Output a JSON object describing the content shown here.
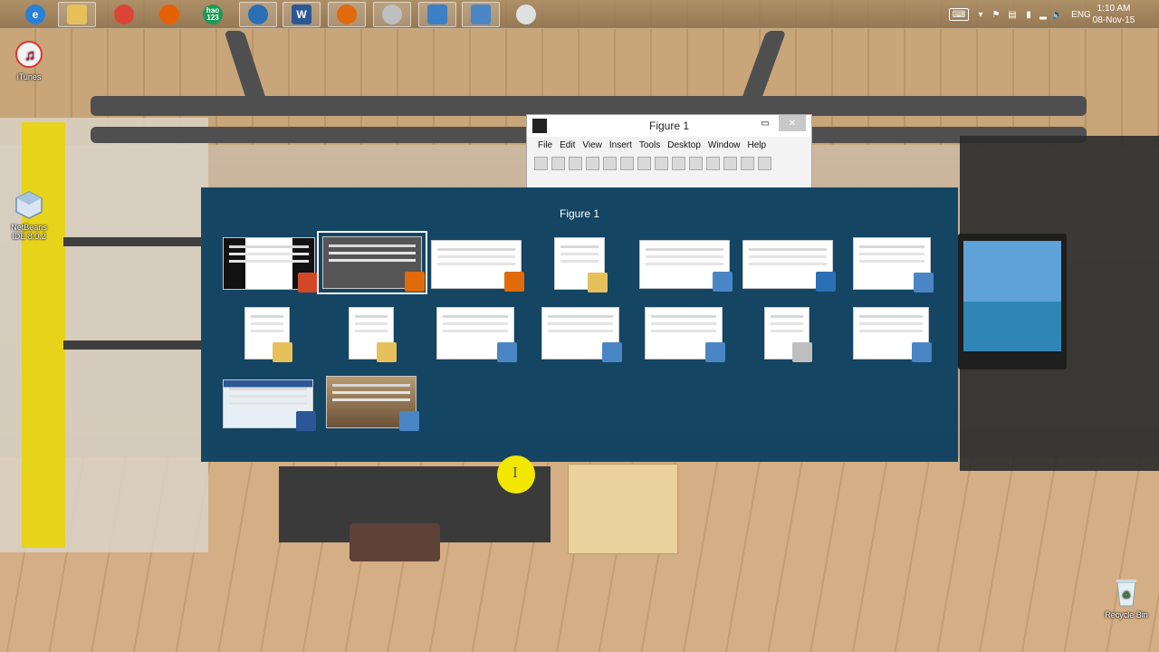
{
  "taskbar": {
    "pinned": [
      {
        "name": "internet-explorer",
        "icon": "ie-icon",
        "glyph": "e",
        "color": "#2a7fd6",
        "framed": false
      },
      {
        "name": "file-explorer",
        "icon": "folder-icon",
        "glyph": "",
        "color": "#e6c15b",
        "framed": true
      },
      {
        "name": "chrome",
        "icon": "chrome-icon",
        "glyph": "",
        "color": "#dc4437",
        "framed": false
      },
      {
        "name": "firefox",
        "icon": "firefox-icon",
        "glyph": "",
        "color": "#e66000",
        "framed": false
      },
      {
        "name": "hao123",
        "icon": "hao123-icon",
        "glyph": "hao\n123",
        "color": "#1e9a55",
        "framed": false
      },
      {
        "name": "refresh-app",
        "icon": "swirl-icon",
        "glyph": "",
        "color": "#2a6fb3",
        "framed": true
      },
      {
        "name": "word",
        "icon": "word-icon",
        "glyph": "W",
        "color": "#2b5797",
        "framed": true
      },
      {
        "name": "matlab",
        "icon": "matlab-icon",
        "glyph": "",
        "color": "#e16a0b",
        "framed": true
      },
      {
        "name": "media-player",
        "icon": "disc-icon",
        "glyph": "",
        "color": "#bfbfbf",
        "framed": true
      },
      {
        "name": "remote-desktop",
        "icon": "monitor-icon",
        "glyph": "",
        "color": "#3b7fc4",
        "framed": true
      },
      {
        "name": "photo-viewer",
        "icon": "picture-icon",
        "glyph": "",
        "color": "#4a86c5",
        "framed": true
      },
      {
        "name": "paint",
        "icon": "palette-icon",
        "glyph": "",
        "color": "#e0e0e0",
        "framed": false
      }
    ],
    "tray": {
      "language": "ENG",
      "time": "1:10 AM",
      "date": "08-Nov-15"
    }
  },
  "desktop_icons": [
    {
      "label": "iTunes",
      "icon": "itunes-icon"
    },
    {
      "label": "NetBeans IDE 8.0.2",
      "icon": "netbeans-icon"
    },
    {
      "label": "Recycle Bin",
      "icon": "recycle-bin-icon"
    }
  ],
  "figure_window": {
    "title": "Figure 1",
    "menu": [
      "File",
      "Edit",
      "View",
      "Insert",
      "Tools",
      "Desktop",
      "Window",
      "Help"
    ]
  },
  "switcher": {
    "title": "Figure 1",
    "thumbnails": [
      {
        "name": "thumb-ppt",
        "badge_icon": "powerpoint-icon",
        "badge_color": "#d24726",
        "selected": false
      },
      {
        "name": "thumb-matlab-figure",
        "badge_icon": "matlab-icon",
        "badge_color": "#e16a0b",
        "selected": true
      },
      {
        "name": "thumb-matlab-editor",
        "badge_icon": "matlab-icon",
        "badge_color": "#e16a0b",
        "selected": false
      },
      {
        "name": "thumb-folder-1",
        "badge_icon": "folder-icon",
        "badge_color": "#e6c15b",
        "selected": false
      },
      {
        "name": "thumb-photo-1",
        "badge_icon": "picture-icon",
        "badge_color": "#4a86c5",
        "selected": false
      },
      {
        "name": "thumb-browser",
        "badge_icon": "swirl-icon",
        "badge_color": "#2a6fb3",
        "selected": false
      },
      {
        "name": "thumb-photo-2",
        "badge_icon": "picture-icon",
        "badge_color": "#4a86c5",
        "selected": false
      },
      {
        "name": "thumb-folder-2",
        "badge_icon": "folder-icon",
        "badge_color": "#e6c15b",
        "selected": false
      },
      {
        "name": "thumb-folder-3",
        "badge_icon": "folder-icon",
        "badge_color": "#e6c15b",
        "selected": false
      },
      {
        "name": "thumb-photo-3",
        "badge_icon": "picture-icon",
        "badge_color": "#4a86c5",
        "selected": false
      },
      {
        "name": "thumb-photo-4",
        "badge_icon": "picture-icon",
        "badge_color": "#4a86c5",
        "selected": false
      },
      {
        "name": "thumb-photo-5",
        "badge_icon": "picture-icon",
        "badge_color": "#4a86c5",
        "selected": false
      },
      {
        "name": "thumb-media",
        "badge_icon": "disc-icon",
        "badge_color": "#bfbfbf",
        "selected": false
      },
      {
        "name": "thumb-photo-6",
        "badge_icon": "picture-icon",
        "badge_color": "#4a86c5",
        "selected": false
      },
      {
        "name": "thumb-word",
        "badge_icon": "word-icon",
        "badge_color": "#2b5797",
        "selected": false
      },
      {
        "name": "thumb-wallpaper",
        "badge_icon": "picture-icon",
        "badge_color": "#4a86c5",
        "selected": false
      }
    ]
  }
}
